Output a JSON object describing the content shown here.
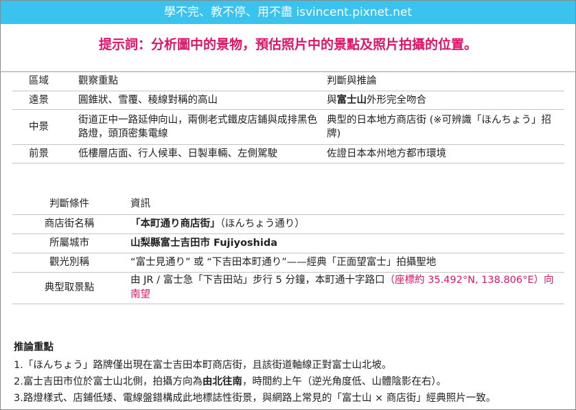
{
  "banner": {
    "text": "學不完、教不停、用不盡 isvincent.pixnet.net"
  },
  "prompt": {
    "text": "提示詞：分析圖中的景物，預估照片中的景點及照片拍攝的位置。"
  },
  "scene_table": {
    "headers": [
      "區域",
      "觀察重點",
      "判斷與推論"
    ],
    "rows": [
      {
        "zone": "遠景",
        "observation": "圓錐狀、雪覆、稜線對稱的高山",
        "inference_pre": "與",
        "inference_bold": "富士山",
        "inference_post": "外形完全吻合"
      },
      {
        "zone": "中景",
        "observation": "街道正中一路延伸向山，兩側老式鐵皮店鋪與成排黑色路燈，頭頂密集電線",
        "inference": "典型的日本地方商店街 (※可辨識「ほんちょう」招牌)"
      },
      {
        "zone": "前景",
        "observation": "低樓層店面、行人候車、日製車輛、左側駕駛",
        "inference": "佐證日本本州地方都市環境"
      }
    ]
  },
  "info_table": {
    "headers": [
      "判斷條件",
      "資訊"
    ],
    "street_label": "商店街名稱",
    "street_bold": "「本町通り商店街」",
    "street_rest": "（ほんちょう通り）",
    "city_label": "所屬城市",
    "city_value": "山梨縣富士吉田市 Fujiyoshida",
    "nickname_label": "觀光別稱",
    "nickname_value": "“富士見通り” 或 “下吉田本町通り”——經典「正面望富士」拍攝聖地",
    "spot_label": "典型取景點",
    "spot_main": "由 JR / 富士急「下吉田站」步行 5 分鐘，本町通十字路口",
    "spot_coords": "（座標約 35.492°N, 138.806°E）向南望"
  },
  "notes": {
    "title": "推論重點",
    "line1": "1.「ほんちょう」路牌僅出現在富士吉田本町商店街，且該街道軸線正對富士山北坡。",
    "line2_pre": "2.富士吉田市位於富士山北側，拍攝方向為",
    "line2_bold": "由北往南",
    "line2_post": "，時間約上午（逆光角度低、山體陰影在右）。",
    "line3": "3.路燈樣式、店鋪低矮、電線盤錯構成此地標誌性街景，與網路上常見的「富士山 × 商店街」經典照片一致。"
  },
  "colors": {
    "banner_bg": "#39c3ee",
    "accent": "#e0136a"
  }
}
